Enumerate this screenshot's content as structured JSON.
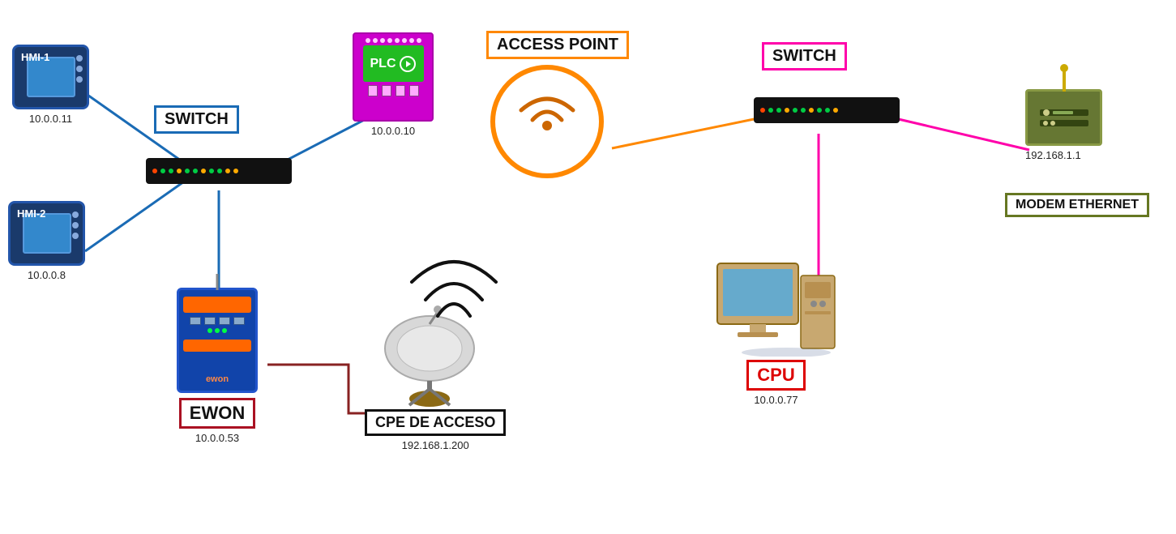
{
  "devices": {
    "hmi1": {
      "label": "HMI-1",
      "ip": "10.0.0.11"
    },
    "hmi2": {
      "label": "HMI-2",
      "ip": "10.0.0.8"
    },
    "switch_left": {
      "label": "SWITCH"
    },
    "plc": {
      "label": "PLC",
      "ip": "10.0.0.10"
    },
    "access_point": {
      "label": "ACCESS POINT"
    },
    "switch_right": {
      "label": "SWITCH"
    },
    "modem": {
      "label": "MODEM ETHERNET",
      "ip": "192.168.1.1"
    },
    "ewon": {
      "label": "EWON",
      "ip": "10.0.0.53"
    },
    "cpe": {
      "label": "CPE DE ACCESO",
      "ip": "192.168.1.200"
    },
    "cpu": {
      "label": "CPU",
      "ip": "10.0.0.77"
    }
  },
  "colors": {
    "switch_left_border": "#1a6bb5",
    "switch_right_border": "#ff00aa",
    "access_point_border": "#ff8800",
    "ewon_border": "#aa1122",
    "cpe_border": "#111111",
    "cpu_border": "#dd0000",
    "modem_border": "#667722",
    "line_blue": "#1a6bb5",
    "line_orange": "#ff8800",
    "line_pink": "#ff00aa",
    "line_dark_red": "#882222",
    "line_dark": "#333333"
  }
}
